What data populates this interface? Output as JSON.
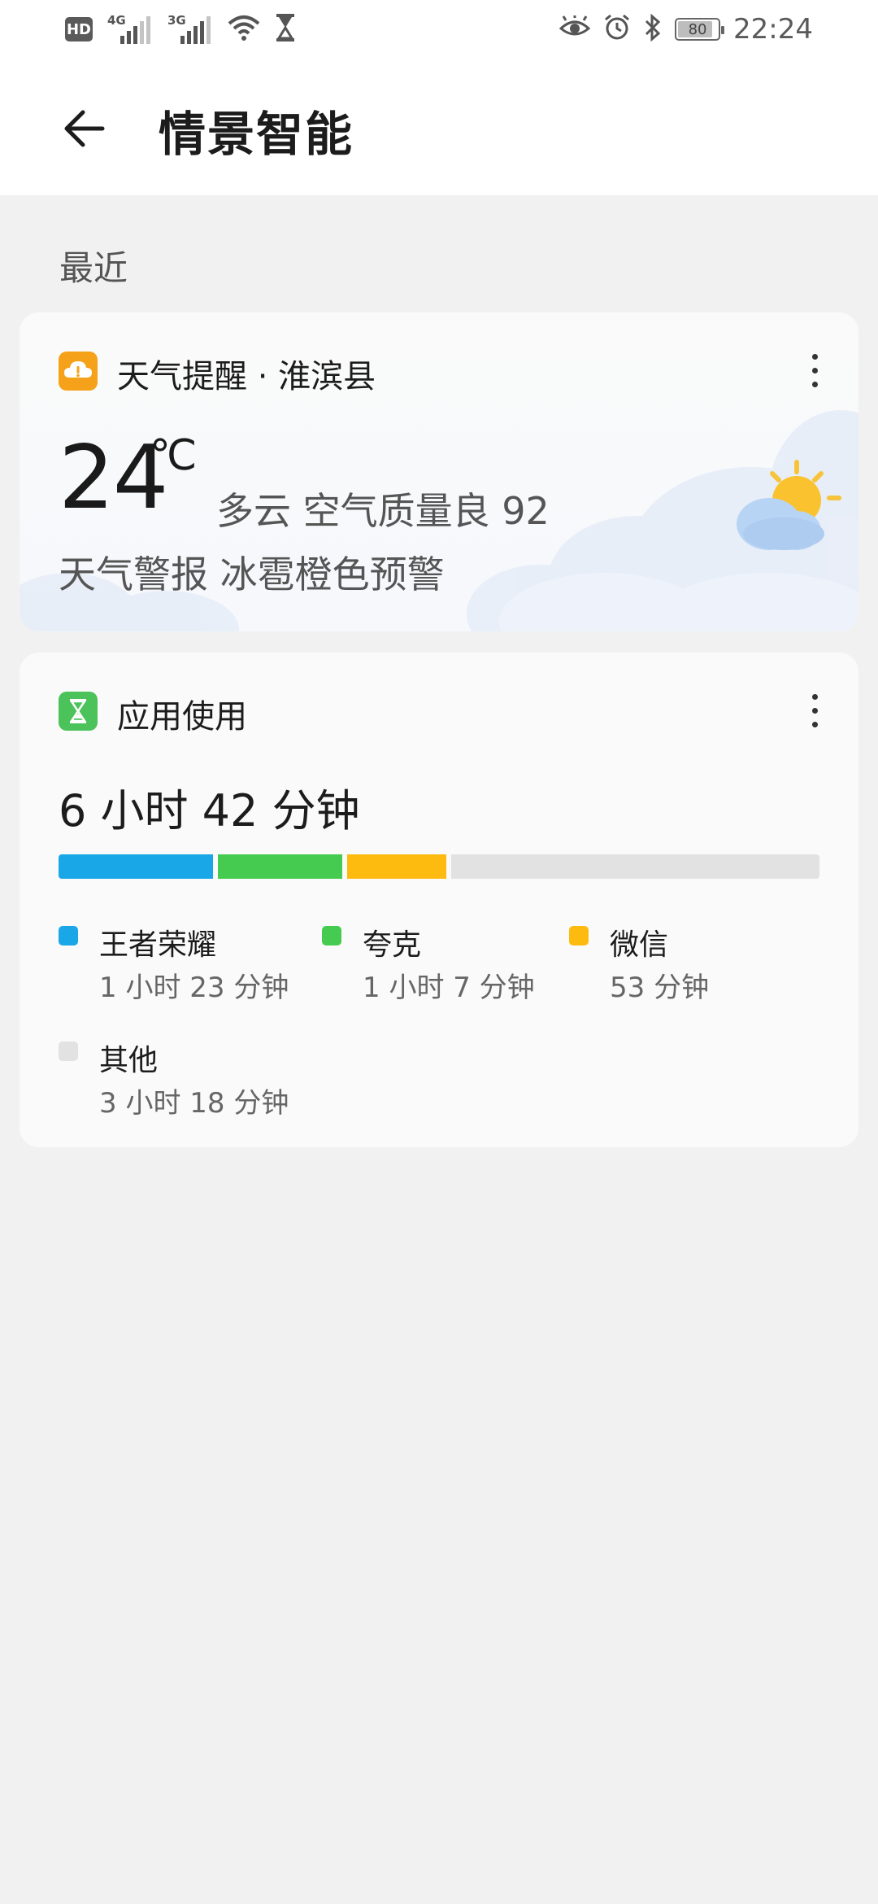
{
  "status_bar": {
    "hd_label": "HD",
    "net1_label": "4G",
    "net2_label": "3G",
    "battery": "80",
    "time": "22:24"
  },
  "header": {
    "title": "情景智能"
  },
  "section": {
    "recent_label": "最近"
  },
  "weather_card": {
    "title": "天气提醒 · 淮滨县",
    "temperature": "24",
    "unit": "℃",
    "description": "多云  空气质量良  92",
    "alert": "天气警报 冰雹橙色预警",
    "colors": {
      "icon_bg": "#F5A21A"
    }
  },
  "usage_card": {
    "title": "应用使用",
    "total": "6 小时 42 分钟",
    "colors": {
      "icon_bg": "#4CC25A"
    },
    "apps": [
      {
        "name": "王者荣耀",
        "time": "1 小时 23 分钟",
        "minutes": 83,
        "color": "#1AA7E8"
      },
      {
        "name": "夸克",
        "time": "1 小时 7 分钟",
        "minutes": 67,
        "color": "#45CB50"
      },
      {
        "name": "微信",
        "time": "53 分钟",
        "minutes": 53,
        "color": "#FDBB10"
      },
      {
        "name": "其他",
        "time": "3 小时 18 分钟",
        "minutes": 198,
        "color": "#E2E2E2"
      }
    ]
  }
}
